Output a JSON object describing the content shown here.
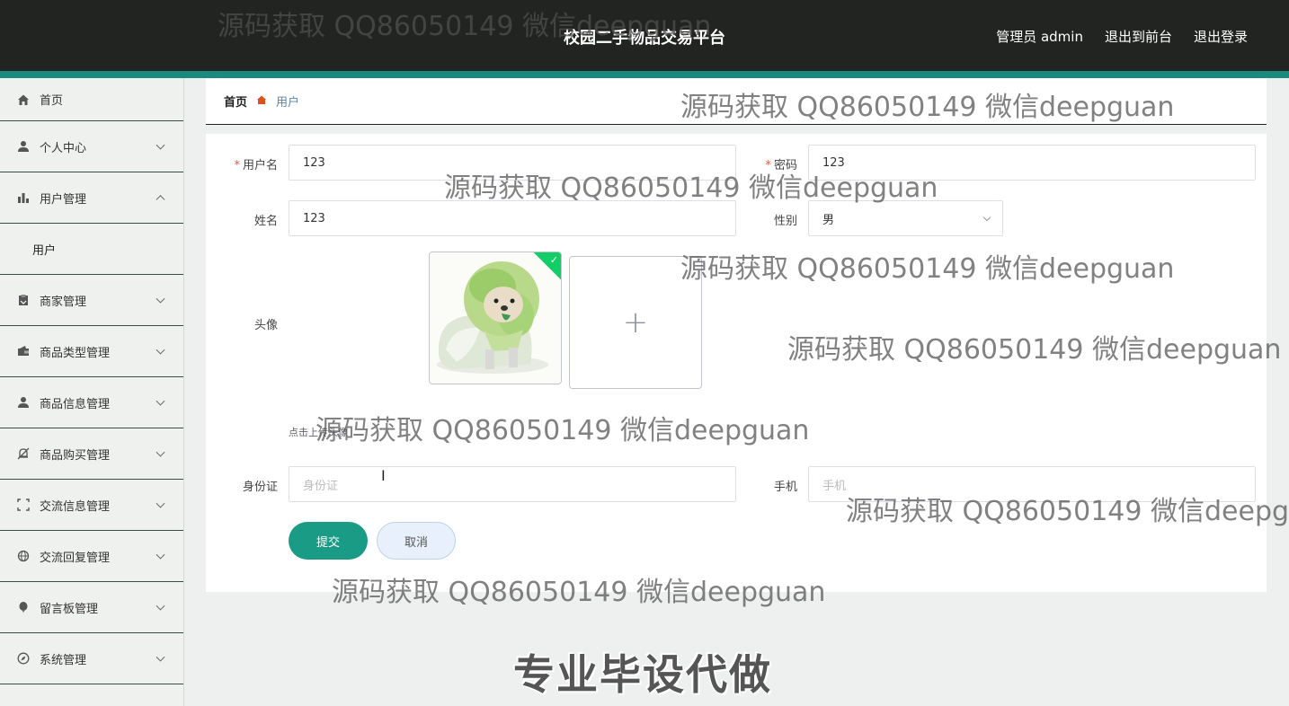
{
  "header": {
    "title": "校园二手物品交易平台",
    "admin_label": "管理员 admin",
    "to_front": "退出到前台",
    "logout": "退出登录"
  },
  "sidebar": {
    "items": [
      {
        "label": "首页",
        "icon": "home-icon"
      },
      {
        "label": "个人中心",
        "icon": "user-icon"
      },
      {
        "label": "用户管理",
        "icon": "bar-chart-icon",
        "expanded": true,
        "children": [
          "用户"
        ]
      },
      {
        "label": "商家管理",
        "icon": "clipboard-icon"
      },
      {
        "label": "商品类型管理",
        "icon": "wallet-icon"
      },
      {
        "label": "商品信息管理",
        "icon": "user-icon"
      },
      {
        "label": "商品购买管理",
        "icon": "bell-off-icon"
      },
      {
        "label": "交流信息管理",
        "icon": "frame-icon"
      },
      {
        "label": "交流回复管理",
        "icon": "globe-icon"
      },
      {
        "label": "留言板管理",
        "icon": "balloon-icon"
      },
      {
        "label": "系统管理",
        "icon": "compass-icon"
      }
    ]
  },
  "breadcrumb": {
    "home": "首页",
    "current": "用户"
  },
  "form": {
    "username_label": "用户名",
    "username_value": "123",
    "password_label": "密码",
    "password_value": "123",
    "name_label": "姓名",
    "name_value": "123",
    "gender_label": "性别",
    "gender_value": "男",
    "avatar_label": "头像",
    "upload_tip": "点击上传头像",
    "idcard_label": "身份证",
    "idcard_placeholder": "身份证",
    "phone_label": "手机",
    "phone_placeholder": "手机",
    "submit": "提交",
    "cancel": "取消"
  },
  "watermark": "源码获取 QQ86050149 微信deepguan",
  "banner": "专业毕设代做",
  "colors": {
    "header_bg": "#222421",
    "accent": "#1a9b86",
    "strip": "#1a8a7e"
  }
}
